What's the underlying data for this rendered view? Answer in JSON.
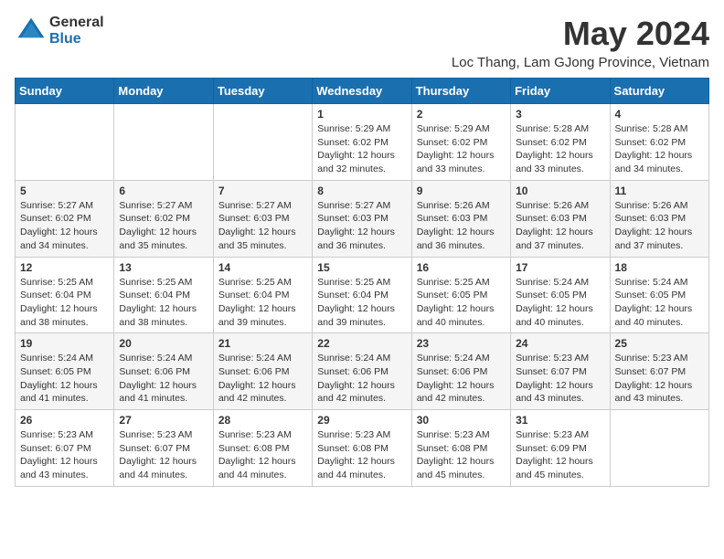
{
  "header": {
    "logo_general": "General",
    "logo_blue": "Blue",
    "month_year": "May 2024",
    "location": "Loc Thang, Lam GJong Province, Vietnam"
  },
  "weekdays": [
    "Sunday",
    "Monday",
    "Tuesday",
    "Wednesday",
    "Thursday",
    "Friday",
    "Saturday"
  ],
  "weeks": [
    [
      {
        "day": "",
        "info": ""
      },
      {
        "day": "",
        "info": ""
      },
      {
        "day": "",
        "info": ""
      },
      {
        "day": "1",
        "info": "Sunrise: 5:29 AM\nSunset: 6:02 PM\nDaylight: 12 hours\nand 32 minutes."
      },
      {
        "day": "2",
        "info": "Sunrise: 5:29 AM\nSunset: 6:02 PM\nDaylight: 12 hours\nand 33 minutes."
      },
      {
        "day": "3",
        "info": "Sunrise: 5:28 AM\nSunset: 6:02 PM\nDaylight: 12 hours\nand 33 minutes."
      },
      {
        "day": "4",
        "info": "Sunrise: 5:28 AM\nSunset: 6:02 PM\nDaylight: 12 hours\nand 34 minutes."
      }
    ],
    [
      {
        "day": "5",
        "info": "Sunrise: 5:27 AM\nSunset: 6:02 PM\nDaylight: 12 hours\nand 34 minutes."
      },
      {
        "day": "6",
        "info": "Sunrise: 5:27 AM\nSunset: 6:02 PM\nDaylight: 12 hours\nand 35 minutes."
      },
      {
        "day": "7",
        "info": "Sunrise: 5:27 AM\nSunset: 6:03 PM\nDaylight: 12 hours\nand 35 minutes."
      },
      {
        "day": "8",
        "info": "Sunrise: 5:27 AM\nSunset: 6:03 PM\nDaylight: 12 hours\nand 36 minutes."
      },
      {
        "day": "9",
        "info": "Sunrise: 5:26 AM\nSunset: 6:03 PM\nDaylight: 12 hours\nand 36 minutes."
      },
      {
        "day": "10",
        "info": "Sunrise: 5:26 AM\nSunset: 6:03 PM\nDaylight: 12 hours\nand 37 minutes."
      },
      {
        "day": "11",
        "info": "Sunrise: 5:26 AM\nSunset: 6:03 PM\nDaylight: 12 hours\nand 37 minutes."
      }
    ],
    [
      {
        "day": "12",
        "info": "Sunrise: 5:25 AM\nSunset: 6:04 PM\nDaylight: 12 hours\nand 38 minutes."
      },
      {
        "day": "13",
        "info": "Sunrise: 5:25 AM\nSunset: 6:04 PM\nDaylight: 12 hours\nand 38 minutes."
      },
      {
        "day": "14",
        "info": "Sunrise: 5:25 AM\nSunset: 6:04 PM\nDaylight: 12 hours\nand 39 minutes."
      },
      {
        "day": "15",
        "info": "Sunrise: 5:25 AM\nSunset: 6:04 PM\nDaylight: 12 hours\nand 39 minutes."
      },
      {
        "day": "16",
        "info": "Sunrise: 5:25 AM\nSunset: 6:05 PM\nDaylight: 12 hours\nand 40 minutes."
      },
      {
        "day": "17",
        "info": "Sunrise: 5:24 AM\nSunset: 6:05 PM\nDaylight: 12 hours\nand 40 minutes."
      },
      {
        "day": "18",
        "info": "Sunrise: 5:24 AM\nSunset: 6:05 PM\nDaylight: 12 hours\nand 40 minutes."
      }
    ],
    [
      {
        "day": "19",
        "info": "Sunrise: 5:24 AM\nSunset: 6:05 PM\nDaylight: 12 hours\nand 41 minutes."
      },
      {
        "day": "20",
        "info": "Sunrise: 5:24 AM\nSunset: 6:06 PM\nDaylight: 12 hours\nand 41 minutes."
      },
      {
        "day": "21",
        "info": "Sunrise: 5:24 AM\nSunset: 6:06 PM\nDaylight: 12 hours\nand 42 minutes."
      },
      {
        "day": "22",
        "info": "Sunrise: 5:24 AM\nSunset: 6:06 PM\nDaylight: 12 hours\nand 42 minutes."
      },
      {
        "day": "23",
        "info": "Sunrise: 5:24 AM\nSunset: 6:06 PM\nDaylight: 12 hours\nand 42 minutes."
      },
      {
        "day": "24",
        "info": "Sunrise: 5:23 AM\nSunset: 6:07 PM\nDaylight: 12 hours\nand 43 minutes."
      },
      {
        "day": "25",
        "info": "Sunrise: 5:23 AM\nSunset: 6:07 PM\nDaylight: 12 hours\nand 43 minutes."
      }
    ],
    [
      {
        "day": "26",
        "info": "Sunrise: 5:23 AM\nSunset: 6:07 PM\nDaylight: 12 hours\nand 43 minutes."
      },
      {
        "day": "27",
        "info": "Sunrise: 5:23 AM\nSunset: 6:07 PM\nDaylight: 12 hours\nand 44 minutes."
      },
      {
        "day": "28",
        "info": "Sunrise: 5:23 AM\nSunset: 6:08 PM\nDaylight: 12 hours\nand 44 minutes."
      },
      {
        "day": "29",
        "info": "Sunrise: 5:23 AM\nSunset: 6:08 PM\nDaylight: 12 hours\nand 44 minutes."
      },
      {
        "day": "30",
        "info": "Sunrise: 5:23 AM\nSunset: 6:08 PM\nDaylight: 12 hours\nand 45 minutes."
      },
      {
        "day": "31",
        "info": "Sunrise: 5:23 AM\nSunset: 6:09 PM\nDaylight: 12 hours\nand 45 minutes."
      },
      {
        "day": "",
        "info": ""
      }
    ]
  ]
}
